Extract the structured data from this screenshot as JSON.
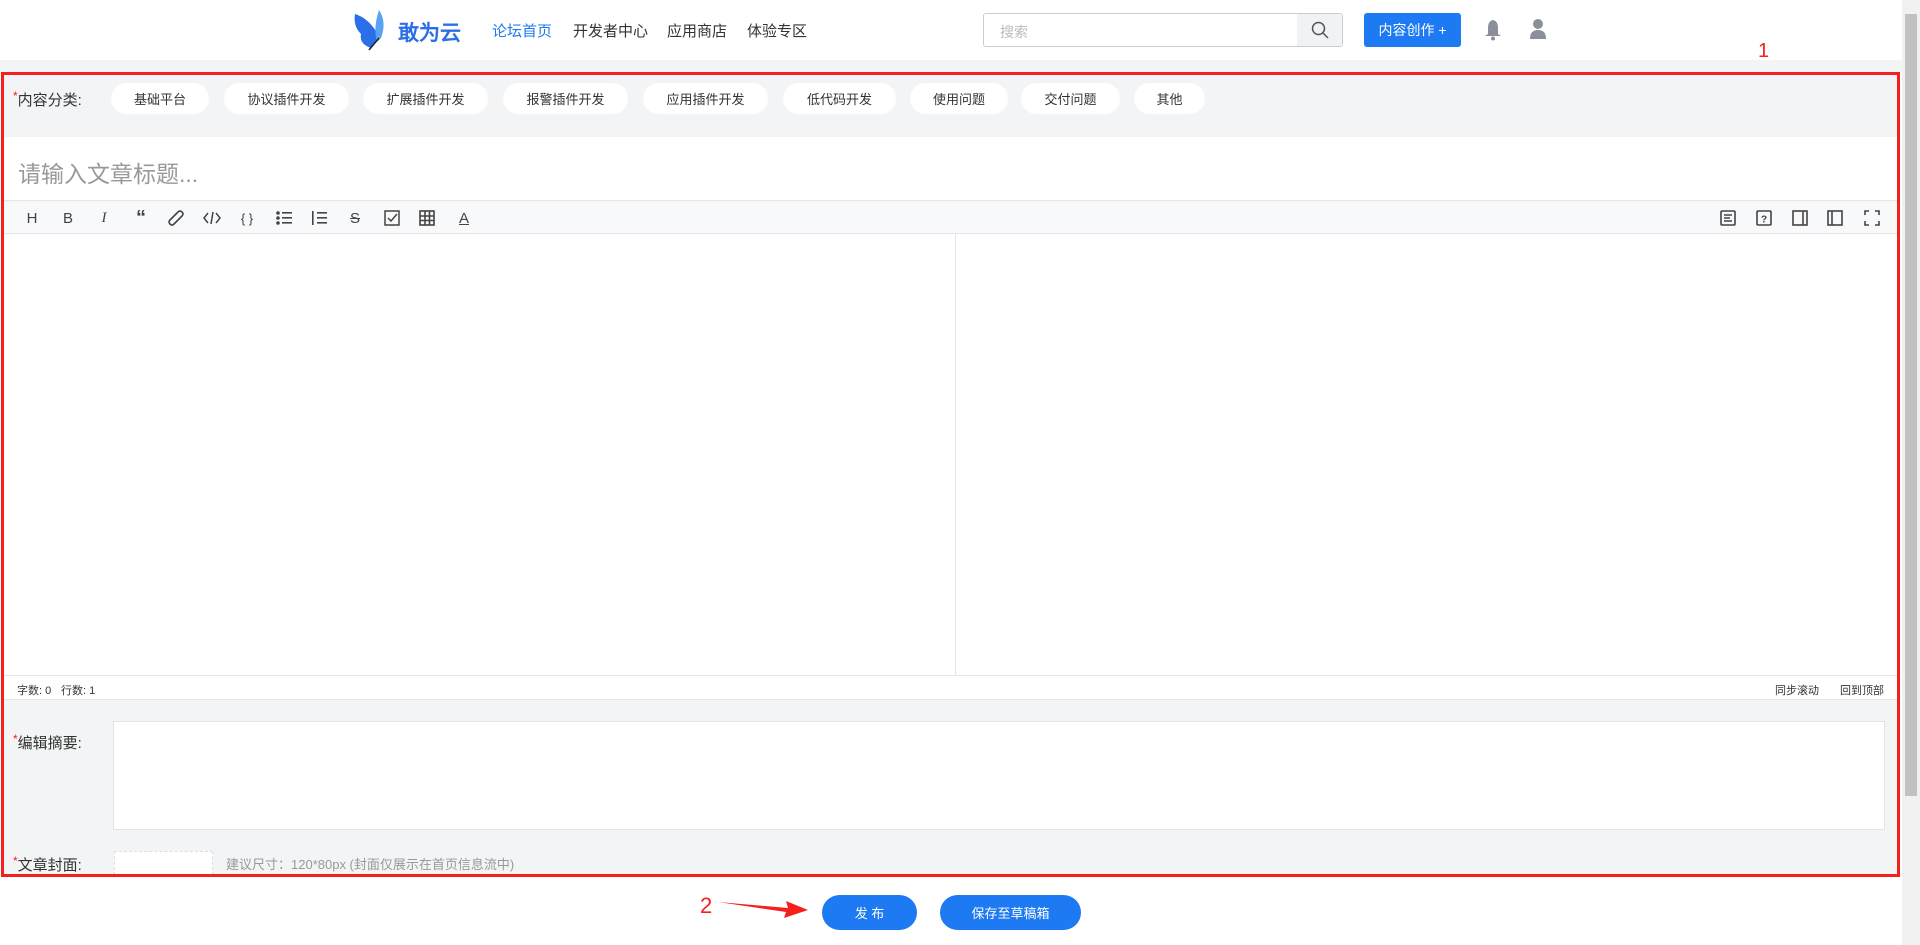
{
  "header": {
    "logo_text": "敢为云",
    "nav": [
      "论坛首页",
      "开发者中心",
      "应用商店",
      "体验专区"
    ],
    "search_placeholder": "搜索",
    "create_button": "内容创作 +"
  },
  "form": {
    "category_label": "内容分类:",
    "categories": [
      "基础平台",
      "协议插件开发",
      "扩展插件开发",
      "报警插件开发",
      "应用插件开发",
      "低代码开发",
      "使用问题",
      "交付问题",
      "其他"
    ],
    "title_placeholder": "请输入文章标题...",
    "toolbar_left": [
      "H",
      "B",
      "I",
      "“",
      "link",
      "</>",
      "{ }",
      "ul",
      "ol",
      "S",
      "task",
      "table",
      "A"
    ],
    "status": {
      "chars": "字数: 0",
      "lines": "行数: 1",
      "sync_scroll": "同步滚动",
      "back_top": "回到顶部"
    },
    "summary_label": "编辑摘要:",
    "cover_label": "文章封面:",
    "cover_hint": "建议尺寸：120*80px (封面仅展示在首页信息流中)",
    "required_mark": "*"
  },
  "actions": {
    "publish": "发 布",
    "save_draft": "保存至草稿箱"
  },
  "annotations": {
    "box": "1",
    "arrow": "2"
  },
  "colors": {
    "primary": "#1d7af3",
    "annotation": "#f5201d"
  }
}
